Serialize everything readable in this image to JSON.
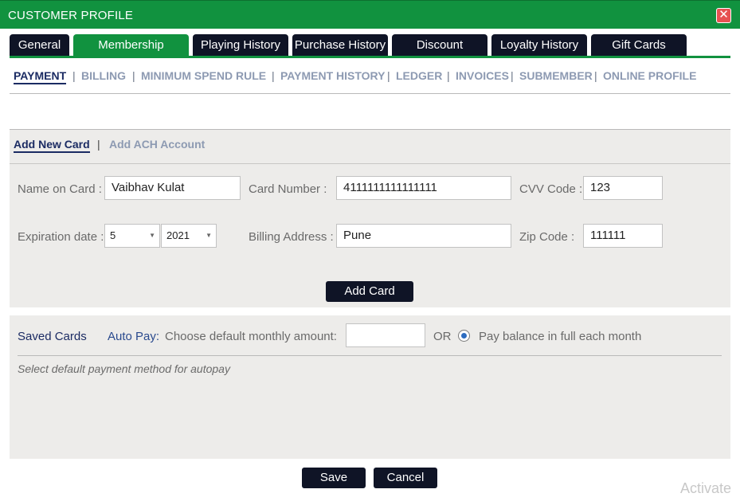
{
  "window": {
    "title": "CUSTOMER PROFILE",
    "close_glyph": "✕"
  },
  "tabs": [
    {
      "label": "General",
      "active": false
    },
    {
      "label": "Membership",
      "active": true
    },
    {
      "label": "Playing History",
      "active": false
    },
    {
      "label": "Purchase History",
      "active": false
    },
    {
      "label": "Discount",
      "active": false
    },
    {
      "label": "Loyalty History",
      "active": false
    },
    {
      "label": "Gift Cards",
      "active": false
    }
  ],
  "subnav": [
    {
      "label": "PAYMENT",
      "active": true
    },
    {
      "label": "BILLING",
      "active": false
    },
    {
      "label": "MINIMUM SPEND RULE",
      "active": false
    },
    {
      "label": "PAYMENT HISTORY",
      "active": false
    },
    {
      "label": "LEDGER",
      "active": false
    },
    {
      "label": "INVOICES",
      "active": false
    },
    {
      "label": "SUBMEMBER",
      "active": false
    },
    {
      "label": "ONLINE PROFILE",
      "active": false
    }
  ],
  "subnav_separator": "|",
  "card_tabs": {
    "add_new_card": "Add New Card",
    "separator": "|",
    "add_ach": "Add ACH Account"
  },
  "form": {
    "name_label": "Name on Card :",
    "name_value": "Vaibhav Kulat",
    "card_number_label": "Card Number :",
    "card_number_value": "4111111111111111",
    "cvv_label": "CVV Code :",
    "cvv_value": "123",
    "expiration_label": "Expiration date :",
    "exp_month": "5",
    "exp_year": "2021",
    "billing_label": "Billing Address :",
    "billing_value": "Pune",
    "zip_label": "Zip Code :",
    "zip_value": "111111",
    "add_card_button": "Add Card"
  },
  "saved_cards": {
    "title": "Saved Cards",
    "autopay_label": "Auto Pay:",
    "choose_label": "Choose default monthly amount:",
    "amount_value": "",
    "or_label": "OR",
    "pay_balance_label": "Pay balance in full each month",
    "pay_balance_selected": true,
    "select_default_text": "Select default payment method for autopay"
  },
  "footer": {
    "save_button": "Save",
    "cancel_button": "Cancel"
  },
  "watermark": "Activate",
  "colors": {
    "brand_green": "#11923f",
    "dark_navy": "#0f1426",
    "link_active": "#1b2b63",
    "link_inactive": "#8d9ab2"
  }
}
